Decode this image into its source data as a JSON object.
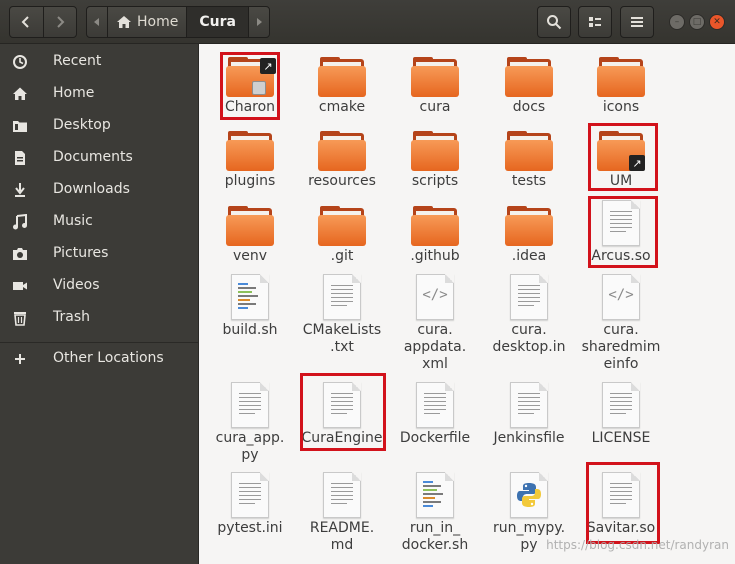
{
  "path": {
    "home_label": "Home",
    "current_label": "Cura"
  },
  "sidebar": {
    "items": [
      {
        "label": "Recent",
        "icon": "clock-icon"
      },
      {
        "label": "Home",
        "icon": "home-icon"
      },
      {
        "label": "Desktop",
        "icon": "folder-icon"
      },
      {
        "label": "Documents",
        "icon": "document-icon"
      },
      {
        "label": "Downloads",
        "icon": "download-icon"
      },
      {
        "label": "Music",
        "icon": "music-icon"
      },
      {
        "label": "Pictures",
        "icon": "camera-icon"
      },
      {
        "label": "Videos",
        "icon": "video-icon"
      },
      {
        "label": "Trash",
        "icon": "trash-icon"
      },
      {
        "label": "Other Locations",
        "icon": "plus-icon"
      }
    ]
  },
  "files": [
    {
      "name": "Charon",
      "kind": "folder",
      "emblem": "link-lock",
      "highlighted": true
    },
    {
      "name": "cmake",
      "kind": "folder"
    },
    {
      "name": "cura",
      "kind": "folder"
    },
    {
      "name": "docs",
      "kind": "folder"
    },
    {
      "name": "icons",
      "kind": "folder"
    },
    {
      "name": "plugins",
      "kind": "folder"
    },
    {
      "name": "resources",
      "kind": "folder"
    },
    {
      "name": "scripts",
      "kind": "folder"
    },
    {
      "name": "tests",
      "kind": "folder"
    },
    {
      "name": "UM",
      "kind": "folder",
      "emblem": "link",
      "highlighted": true
    },
    {
      "name": "venv",
      "kind": "folder"
    },
    {
      "name": ".git",
      "kind": "folder"
    },
    {
      "name": ".github",
      "kind": "folder"
    },
    {
      "name": ".idea",
      "kind": "folder"
    },
    {
      "name": "Arcus.so",
      "kind": "document",
      "highlighted": true
    },
    {
      "name": "build.sh",
      "kind": "script"
    },
    {
      "name": "CMakeLists\n.txt",
      "kind": "document"
    },
    {
      "name": "cura.\nappdata.\nxml",
      "kind": "xml"
    },
    {
      "name": "cura.\ndesktop.in",
      "kind": "document"
    },
    {
      "name": "cura.\nsharedmim\neinfo",
      "kind": "xml"
    },
    {
      "name": "cura_app.\npy",
      "kind": "document"
    },
    {
      "name": "CuraEngine",
      "kind": "document",
      "highlighted": true
    },
    {
      "name": "Dockerfile",
      "kind": "document"
    },
    {
      "name": "Jenkinsfile",
      "kind": "document"
    },
    {
      "name": "LICENSE",
      "kind": "document"
    },
    {
      "name": "pytest.ini",
      "kind": "document"
    },
    {
      "name": "README.\nmd",
      "kind": "document"
    },
    {
      "name": "run_in_\ndocker.sh",
      "kind": "script"
    },
    {
      "name": "run_mypy.\npy",
      "kind": "python"
    },
    {
      "name": "Savitar.so",
      "kind": "document",
      "highlighted": true
    }
  ],
  "watermark": "https://blog.csdn.net/randyran",
  "colors": {
    "highlight": "#d2121b",
    "folder": "#e6661f",
    "sidebar": "#3c3b37",
    "content": "#f6f5f4"
  }
}
